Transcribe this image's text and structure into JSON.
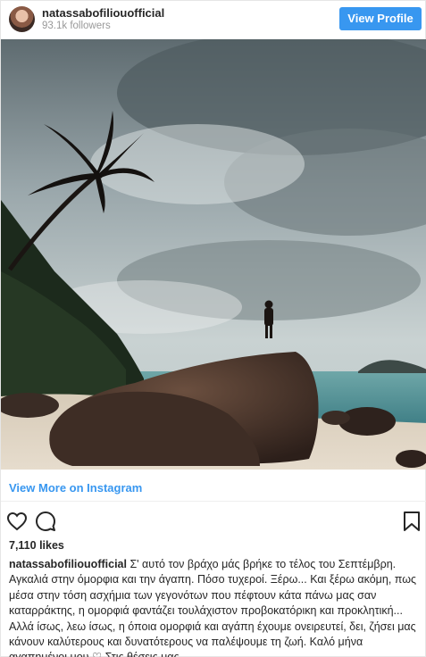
{
  "header": {
    "username": "natassabofiliouofficial",
    "followers": "93.1k followers",
    "view_profile_label": "View Profile"
  },
  "post": {
    "view_more_label": "View More on Instagram",
    "likes": "7,110 likes",
    "caption_user": "natassabofiliouofficial",
    "caption_text": "Σ' αυτό τον βράχο μάς βρήκε το τέλος του Σεπτέμβρη. Αγκαλιά στην όμορφια και την άγαπη. Πόσο τυχεροί. Ξέρω... Και ξέρω ακόμη, πως μέσα στην τόση ασχήμια των γεγονότων που πέφτουν κάτα πάνω μας σαν καταρράκτης, η ομορφιά φαντάζει τουλάχιστον προβοκατόρικη και προκλητική... Αλλά ίσως, λεω ίσως, η όποια ομορφιά και αγάπη έχουμε ονειρευτεί, δει, ζήσει μας κάνουν καλύτερους και δυνατότερους να παλέψουμε τη ζωή. Καλό μήνα αγαπημένοι μου ♡ Στις θέσεις μας."
  },
  "icons": {
    "like": "heart-icon",
    "comment": "comment-icon",
    "save": "bookmark-icon",
    "avatar": "profile-avatar"
  },
  "colors": {
    "accent": "#3897f0",
    "text": "#262626",
    "muted": "#999999"
  }
}
